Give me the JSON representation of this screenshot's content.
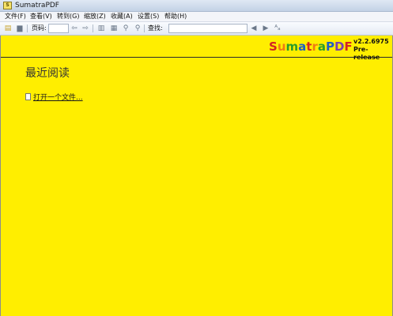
{
  "window": {
    "title": "SumatraPDF",
    "app_icon": "sumatra-app-icon"
  },
  "menu": [
    {
      "label": "文件(F)"
    },
    {
      "label": "查看(V)"
    },
    {
      "label": "转到(G)"
    },
    {
      "label": "缩放(Z)"
    },
    {
      "label": "收藏(A)"
    },
    {
      "label": "设置(S)"
    },
    {
      "label": "帮助(H)"
    }
  ],
  "toolbar": {
    "page_label": "页码:",
    "page_value": "",
    "search_label": "查找:",
    "search_value": "",
    "icons": [
      "open-icon",
      "print-icon",
      "prev-page-icon",
      "next-page-icon",
      "single-page-icon",
      "facing-page-icon",
      "zoom-in-icon",
      "zoom-out-icon",
      "find-prev-icon",
      "find-next-icon",
      "match-case-icon"
    ]
  },
  "brand": {
    "letters": [
      "S",
      "u",
      "m",
      "a",
      "t",
      "r",
      "a",
      "P",
      "D",
      "F"
    ],
    "version": "v2.2.6975",
    "prerelease": "Pre-release",
    "colors": {
      "red": "#d42424",
      "orange": "#f07a13",
      "green": "#2a9d2a",
      "blue": "#1d5fc4",
      "purple": "#7a3fb0"
    }
  },
  "content": {
    "background": "#ffee00",
    "recent_title": "最近阅读",
    "open_file_link": "打开一个文件..."
  }
}
